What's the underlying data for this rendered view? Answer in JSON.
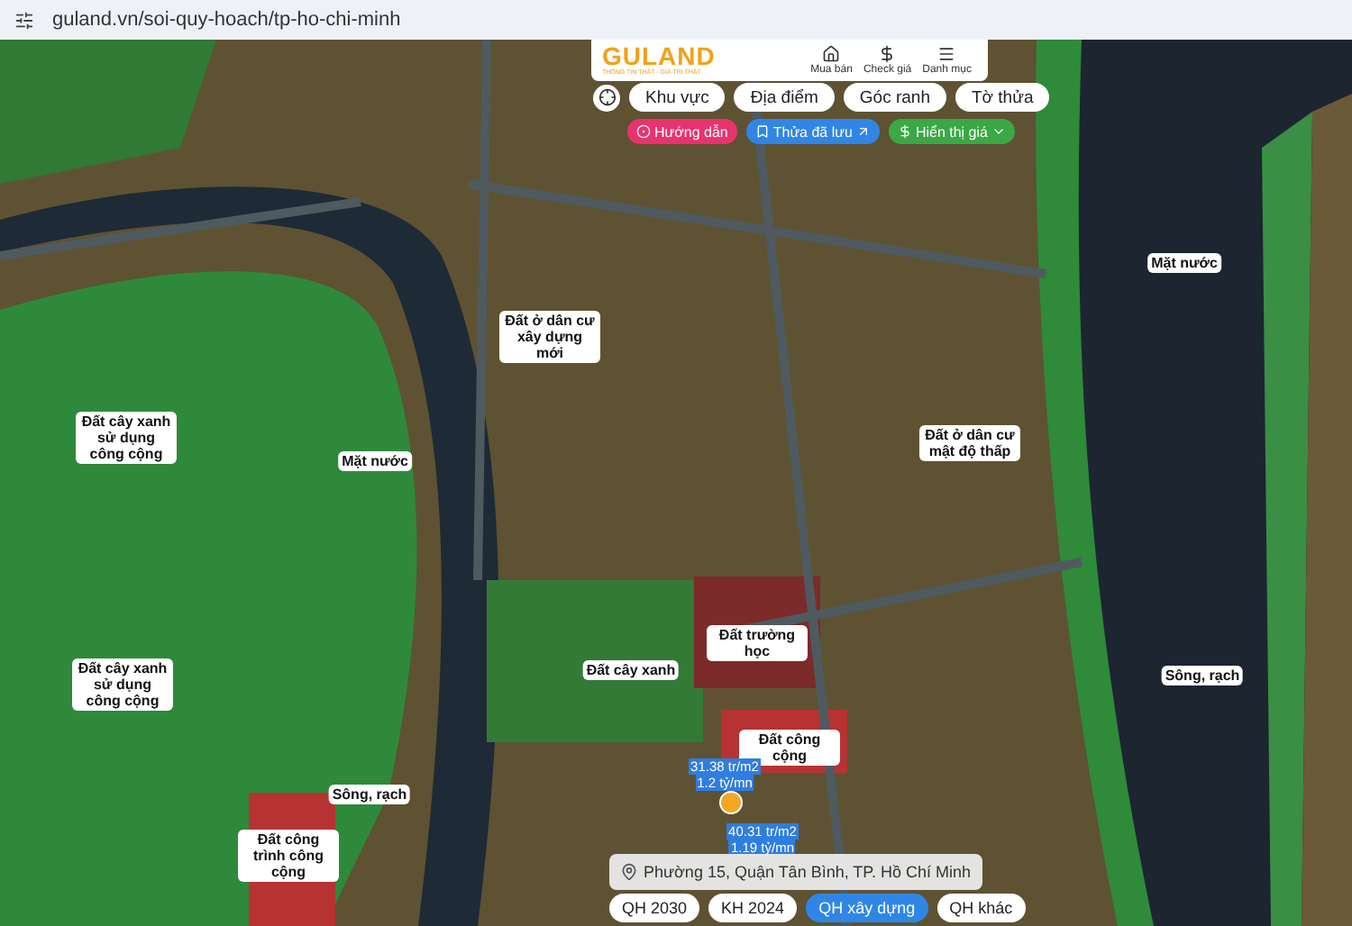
{
  "browser": {
    "url": "guland.vn/soi-quy-hoach/tp-ho-chi-minh"
  },
  "header": {
    "logo": "GULAND",
    "tagline": "THÔNG TIN THẬT - GIÁ TRỊ THẬT",
    "actions": [
      {
        "kind": "house",
        "label": "Mua bán"
      },
      {
        "kind": "price",
        "label": "Check giá"
      },
      {
        "kind": "menu",
        "label": "Danh mục"
      }
    ]
  },
  "search_chips": [
    {
      "label": "Khu vực"
    },
    {
      "label": "Địa điểm"
    },
    {
      "label": "Góc ranh"
    },
    {
      "label": "Tờ thửa"
    }
  ],
  "quick_actions": [
    {
      "kind": "guide",
      "label": "Hướng dẫn",
      "color": "#e8336f"
    },
    {
      "kind": "saved",
      "label": "Thửa đã lưu",
      "color": "#2f86e6"
    },
    {
      "kind": "price",
      "label": "Hiển thị giá",
      "color": "#3aa845"
    }
  ],
  "map": {
    "zones": [
      {
        "label": "Đất ở dân cư xây dựng mới"
      },
      {
        "label": "Đất cây xanh sử dụng công cộng"
      },
      {
        "label": "Mặt nước"
      },
      {
        "label": "Mặt nước"
      },
      {
        "label": "Đất ở dân cư mật độ thấp"
      },
      {
        "label": "Đất trường học"
      },
      {
        "label": "Đất cây xanh sử dụng công cộng"
      },
      {
        "label": "Đất cây xanh"
      },
      {
        "label": "Sông, rạch"
      },
      {
        "label": "Đất công cộng"
      },
      {
        "label": "Sông, rạch"
      },
      {
        "label": "Đất công trình công cộng"
      }
    ],
    "price_tags": [
      {
        "price": "31.38 tr/m2",
        "total": "1.2 tỷ/mn"
      },
      {
        "price": "40.31 tr/m2",
        "total": "1.19 tỷ/mn"
      }
    ]
  },
  "address": "Phường 15, Quận Tân Bình, TP. Hồ Chí Minh",
  "layer_tabs": [
    {
      "label": "QH 2030",
      "selected": false
    },
    {
      "label": "KH 2024",
      "selected": false
    },
    {
      "label": "QH xây dựng",
      "selected": true
    },
    {
      "label": "QH khác",
      "selected": false
    }
  ]
}
